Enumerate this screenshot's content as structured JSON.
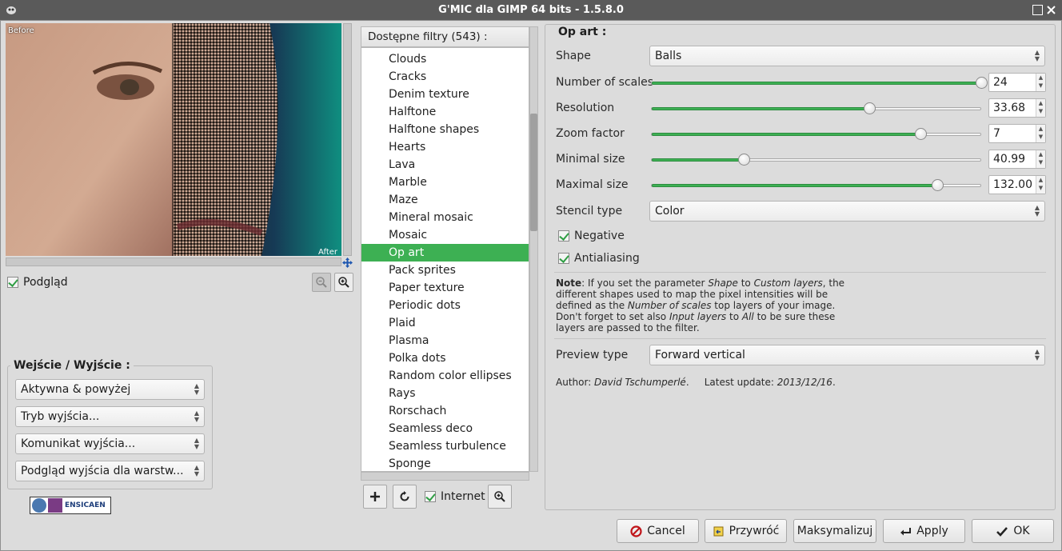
{
  "window": {
    "title": "G'MIC dla GIMP 64 bits - 1.5.8.0",
    "app_icon": "wilber-icon",
    "controls": [
      "maximize-icon",
      "close-icon"
    ]
  },
  "preview": {
    "before_label": "Before",
    "after_label": "After",
    "checkbox_label": "Podgląd",
    "checkbox_checked": true,
    "zoom_out_icon": "zoom-out-icon",
    "zoom_in_icon": "zoom-in-icon",
    "move_icon": "move-arrows-icon"
  },
  "io": {
    "title": "Wejście / Wyjście :",
    "combos": [
      "Aktywna & powyżej",
      "Tryb wyjścia...",
      "Komunikat wyjścia...",
      "Podgląd wyjścia dla warstw..."
    ]
  },
  "logo": {
    "text": "ENSICAEN",
    "badge": "grey"
  },
  "filters": {
    "header": "Dostępne filtry (543) :",
    "items": [
      "Clouds",
      "Cracks",
      "Denim texture",
      "Halftone",
      "Halftone shapes",
      "Hearts",
      "Lava",
      "Marble",
      "Maze",
      "Mineral mosaic",
      "Mosaic",
      "Op art",
      "Pack sprites",
      "Paper texture",
      "Periodic dots",
      "Plaid",
      "Plasma",
      "Polka dots",
      "Random color ellipses",
      "Rays",
      "Rorschach",
      "Seamless deco",
      "Seamless turbulence",
      "Sponge"
    ],
    "selected": "Op art",
    "internet_label": "Internet",
    "internet_checked": true,
    "buttons": [
      "add-icon",
      "refresh-icon",
      "zoom-in-icon"
    ]
  },
  "params": {
    "title": "Op art :",
    "shape_label": "Shape",
    "shape_value": "Balls",
    "sliders": [
      {
        "label": "Number of scales",
        "value": "24",
        "fraction": 1.0
      },
      {
        "label": "Resolution",
        "value": "33.68",
        "fraction": 0.66
      },
      {
        "label": "Zoom factor",
        "value": "7",
        "fraction": 0.817
      },
      {
        "label": "Minimal size",
        "value": "40.99",
        "fraction": 0.28
      },
      {
        "label": "Maximal size",
        "value": "132.00",
        "fraction": 0.866
      }
    ],
    "stencil_label": "Stencil type",
    "stencil_value": "Color",
    "negative_label": "Negative",
    "negative_checked": true,
    "antialiasing_label": "Antialiasing",
    "antialiasing_checked": true,
    "note": {
      "bold": "Note",
      "t1": ": If you set the parameter ",
      "i1": "Shape",
      "t2": " to ",
      "i2": "Custom layers",
      "t3": ", the different shapes used to map the pixel intensities will be defined as the ",
      "i3": "Number of scales",
      "t4": " top layers of your image. Don't forget to set also ",
      "i4": "Input layers",
      "t5": " to ",
      "i5": "All",
      "t6": " to be sure these layers are passed to the filter."
    },
    "preview_type_label": "Preview type",
    "preview_type_value": "Forward vertical",
    "author_prefix": "Author: ",
    "author": "David Tschumperlé",
    "update_prefix": ".     Latest update: ",
    "update": "2013/12/16",
    "update_suffix": "."
  },
  "buttons": {
    "cancel": {
      "label": "Cancel",
      "icon": "cancel-icon"
    },
    "reset": {
      "label": "Przywróć",
      "icon": "reset-icon"
    },
    "maximize": {
      "label": "Maksymalizuj"
    },
    "apply": {
      "label": "Apply",
      "icon": "apply-arrow-icon"
    },
    "ok": {
      "label": "OK",
      "icon": "checkmark-icon"
    }
  }
}
